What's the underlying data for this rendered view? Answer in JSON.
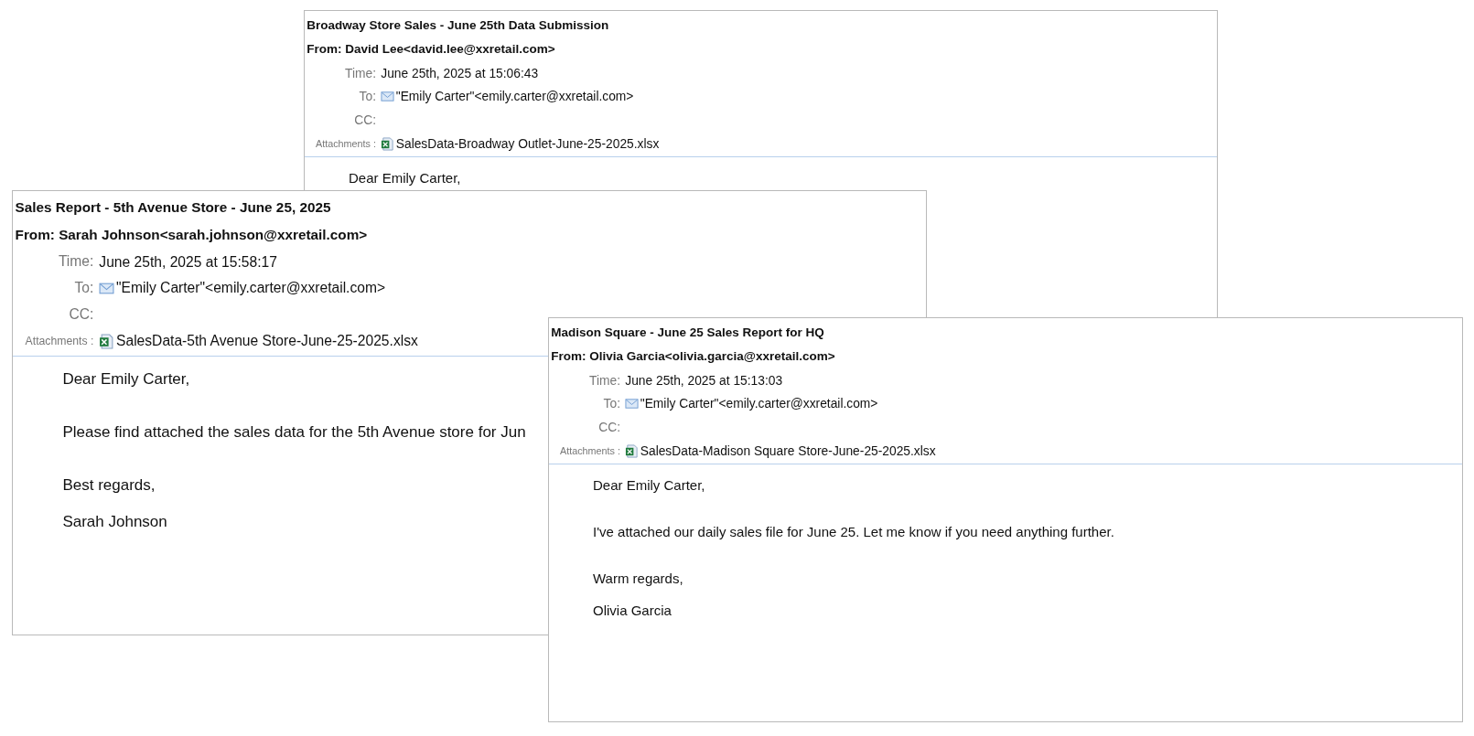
{
  "windows": [
    {
      "subject": "Broadway Store Sales - June 25th Data Submission",
      "from": "From: David Lee<david.lee@xxretail.com>",
      "fields": [
        {
          "kind": "text",
          "label": "Time:",
          "value": "June 25th, 2025 at 15:06:43"
        },
        {
          "kind": "recipient",
          "label": "To:",
          "value": "\"Emily Carter\"<emily.carter@xxretail.com>"
        },
        {
          "kind": "text",
          "label": "CC:"
        },
        {
          "kind": "attachment",
          "label": "Attachments :",
          "value": "SalesData-Broadway Outlet-June-25-2025.xlsx"
        }
      ],
      "body": [
        "Dear Emily Carter,"
      ]
    },
    {
      "subject": "Sales Report - 5th Avenue Store - June 25, 2025",
      "from": "From: Sarah Johnson<sarah.johnson@xxretail.com>",
      "fields": [
        {
          "kind": "text",
          "label": "Time:",
          "value": "June 25th, 2025 at 15:58:17"
        },
        {
          "kind": "recipient",
          "label": "To:",
          "value": "\"Emily Carter\"<emily.carter@xxretail.com>"
        },
        {
          "kind": "text",
          "label": "CC:"
        },
        {
          "kind": "attachment",
          "label": "Attachments :",
          "value": "SalesData-5th Avenue Store-June-25-2025.xlsx"
        }
      ],
      "body": [
        "Dear Emily Carter,",
        "Please find attached the sales data for the 5th Avenue store for Jun",
        "Best regards,",
        "Sarah Johnson"
      ]
    },
    {
      "subject": "Madison Square - June 25 Sales Report for HQ",
      "from": "From: Olivia Garcia<olivia.garcia@xxretail.com>",
      "fields": [
        {
          "kind": "text",
          "label": "Time:",
          "value": "June 25th, 2025 at 15:13:03"
        },
        {
          "kind": "recipient",
          "label": "To:",
          "value": "\"Emily Carter\"<emily.carter@xxretail.com>"
        },
        {
          "kind": "text",
          "label": "CC:"
        },
        {
          "kind": "attachment",
          "label": "Attachments :",
          "value": "SalesData-Madison Square Store-June-25-2025.xlsx"
        }
      ],
      "body": [
        "Dear Emily Carter,",
        "I've attached our daily sales file for June 25. Let me know if you need anything further.",
        "Warm regards,",
        "Olivia Garcia"
      ]
    }
  ]
}
